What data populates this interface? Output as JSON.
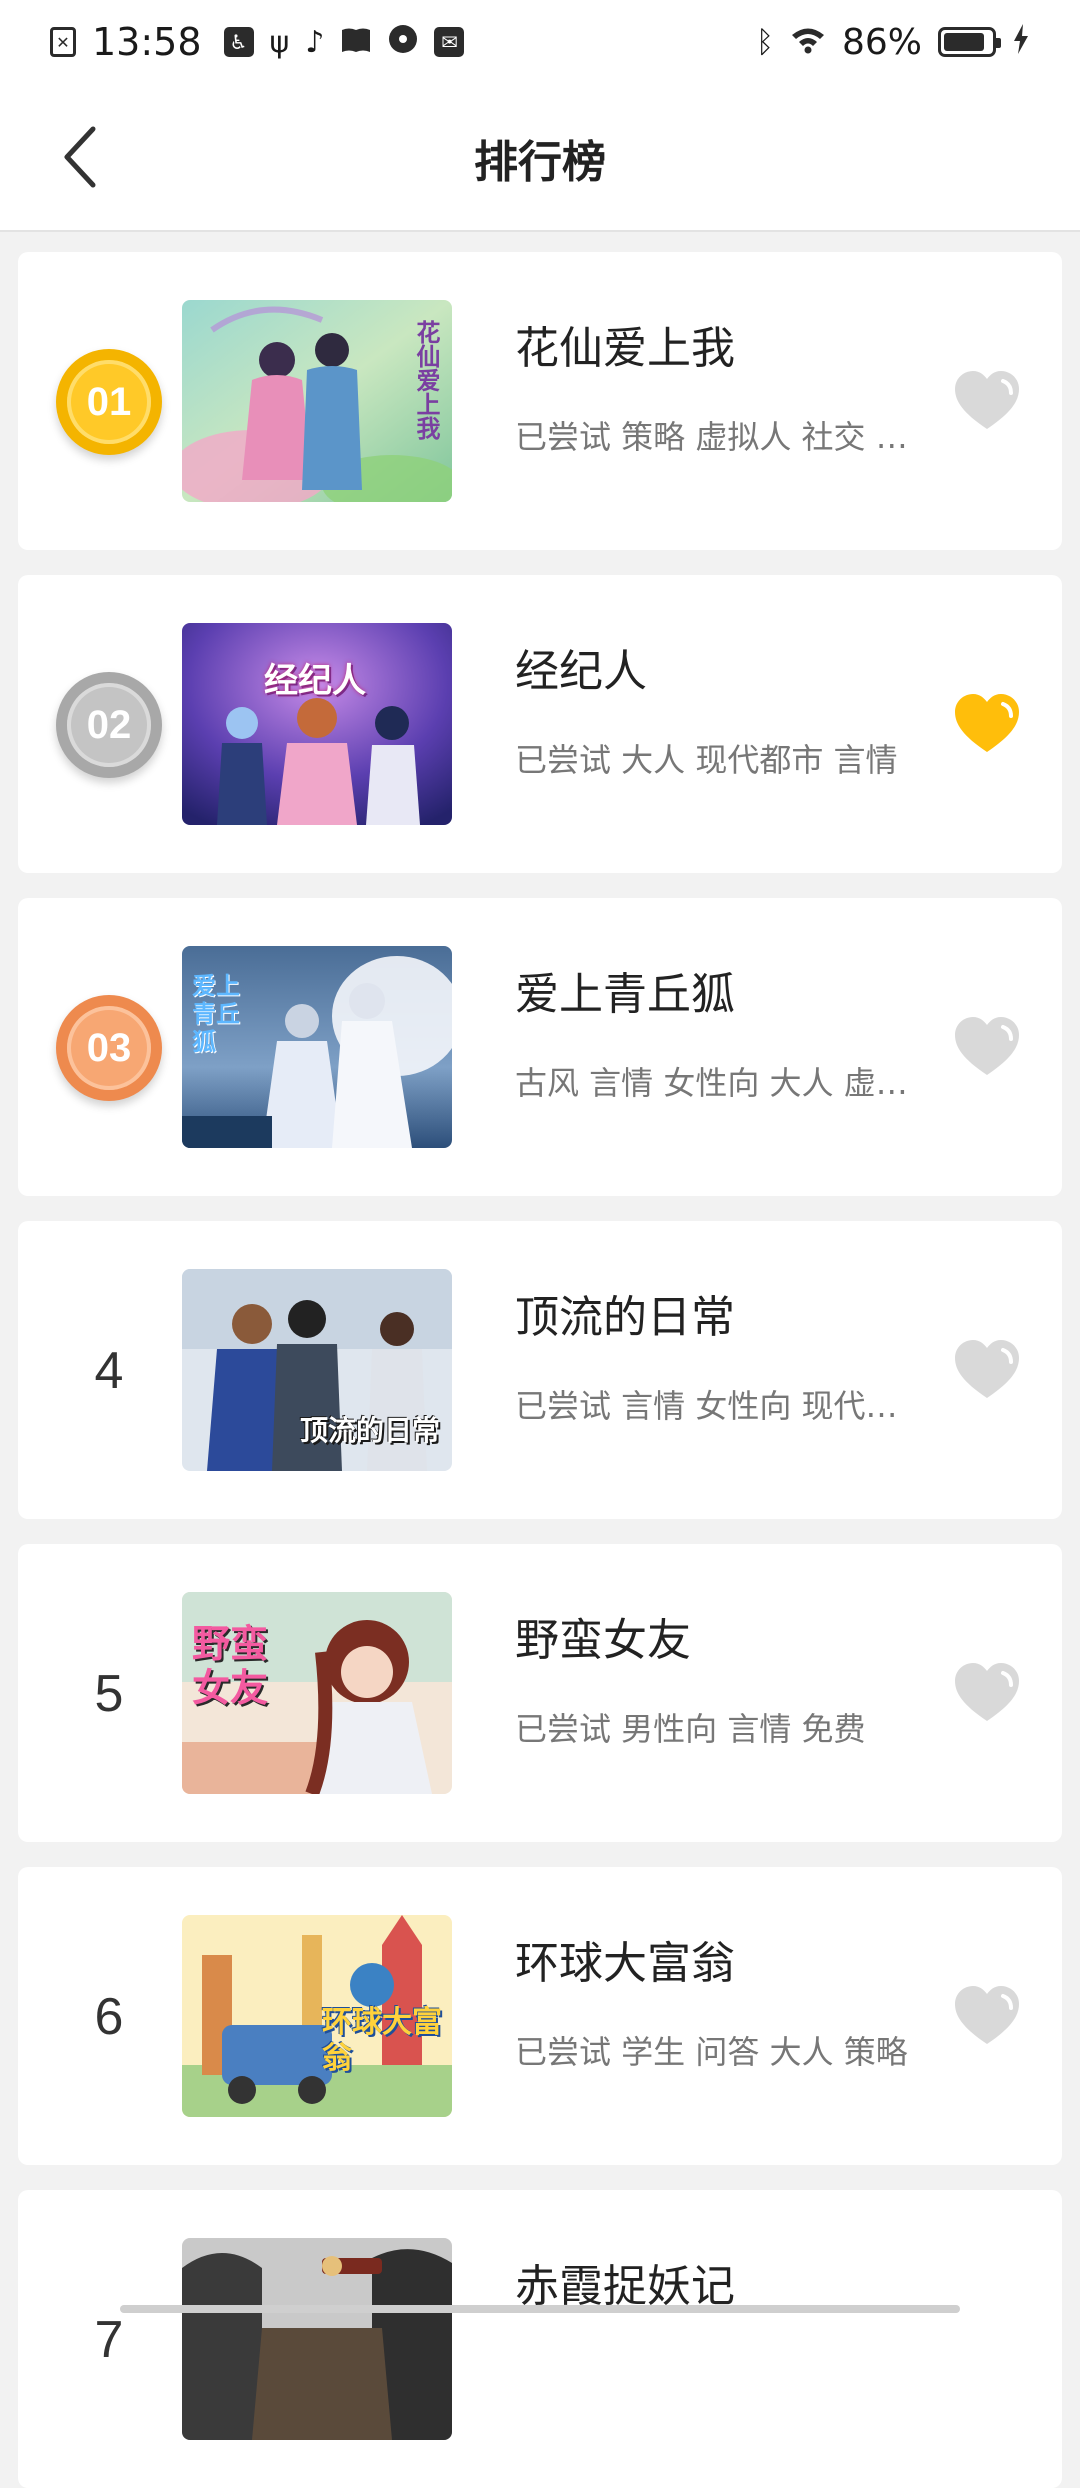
{
  "status_bar": {
    "time": "13:58",
    "battery": "86%",
    "battery_level": 0.86,
    "left_icons": [
      "sim-off-icon",
      "accessibility-icon",
      "usb-icon",
      "tiktok-icon",
      "book-icon",
      "radio-icon",
      "mail-icon"
    ],
    "right_icons": [
      "bluetooth-icon",
      "wifi-icon",
      "battery-icon",
      "charging-icon"
    ]
  },
  "header": {
    "title": "排行榜",
    "back_icon": "chevron-left-icon"
  },
  "colors": {
    "gold": "#ffc928",
    "silver": "#c4c4c4",
    "bronze": "#f7a773",
    "fav_active": "#ffbe0b",
    "fav_inactive": "#d9d9d9"
  },
  "items": [
    {
      "rank": "01",
      "title": "花仙爱上我",
      "tags": "已尝试 策略 虚拟人 社交 女性向",
      "favorited": false,
      "thumb_text": "花仙爱上我"
    },
    {
      "rank": "02",
      "title": "经纪人",
      "tags": "已尝试 大人 现代都市 言情",
      "favorited": true,
      "thumb_text": "经纪人"
    },
    {
      "rank": "03",
      "title": "爱上青丘狐",
      "tags": "古风 言情 女性向 大人 虚拟人",
      "favorited": false,
      "thumb_text": "爱上青丘狐"
    },
    {
      "rank": "4",
      "title": "顶流的日常",
      "tags": "已尝试 言情 女性向 现代都市",
      "favorited": false,
      "thumb_text": "顶流的日常"
    },
    {
      "rank": "5",
      "title": "野蛮女友",
      "tags": "已尝试 男性向 言情 免费",
      "favorited": false,
      "thumb_text": "野蛮女友"
    },
    {
      "rank": "6",
      "title": "环球大富翁",
      "tags": "已尝试 学生 问答 大人 策略",
      "favorited": false,
      "thumb_text": "环球大富翁"
    },
    {
      "rank": "7",
      "title": "赤霞捉妖记",
      "tags": "",
      "favorited": false,
      "thumb_text": ""
    }
  ]
}
